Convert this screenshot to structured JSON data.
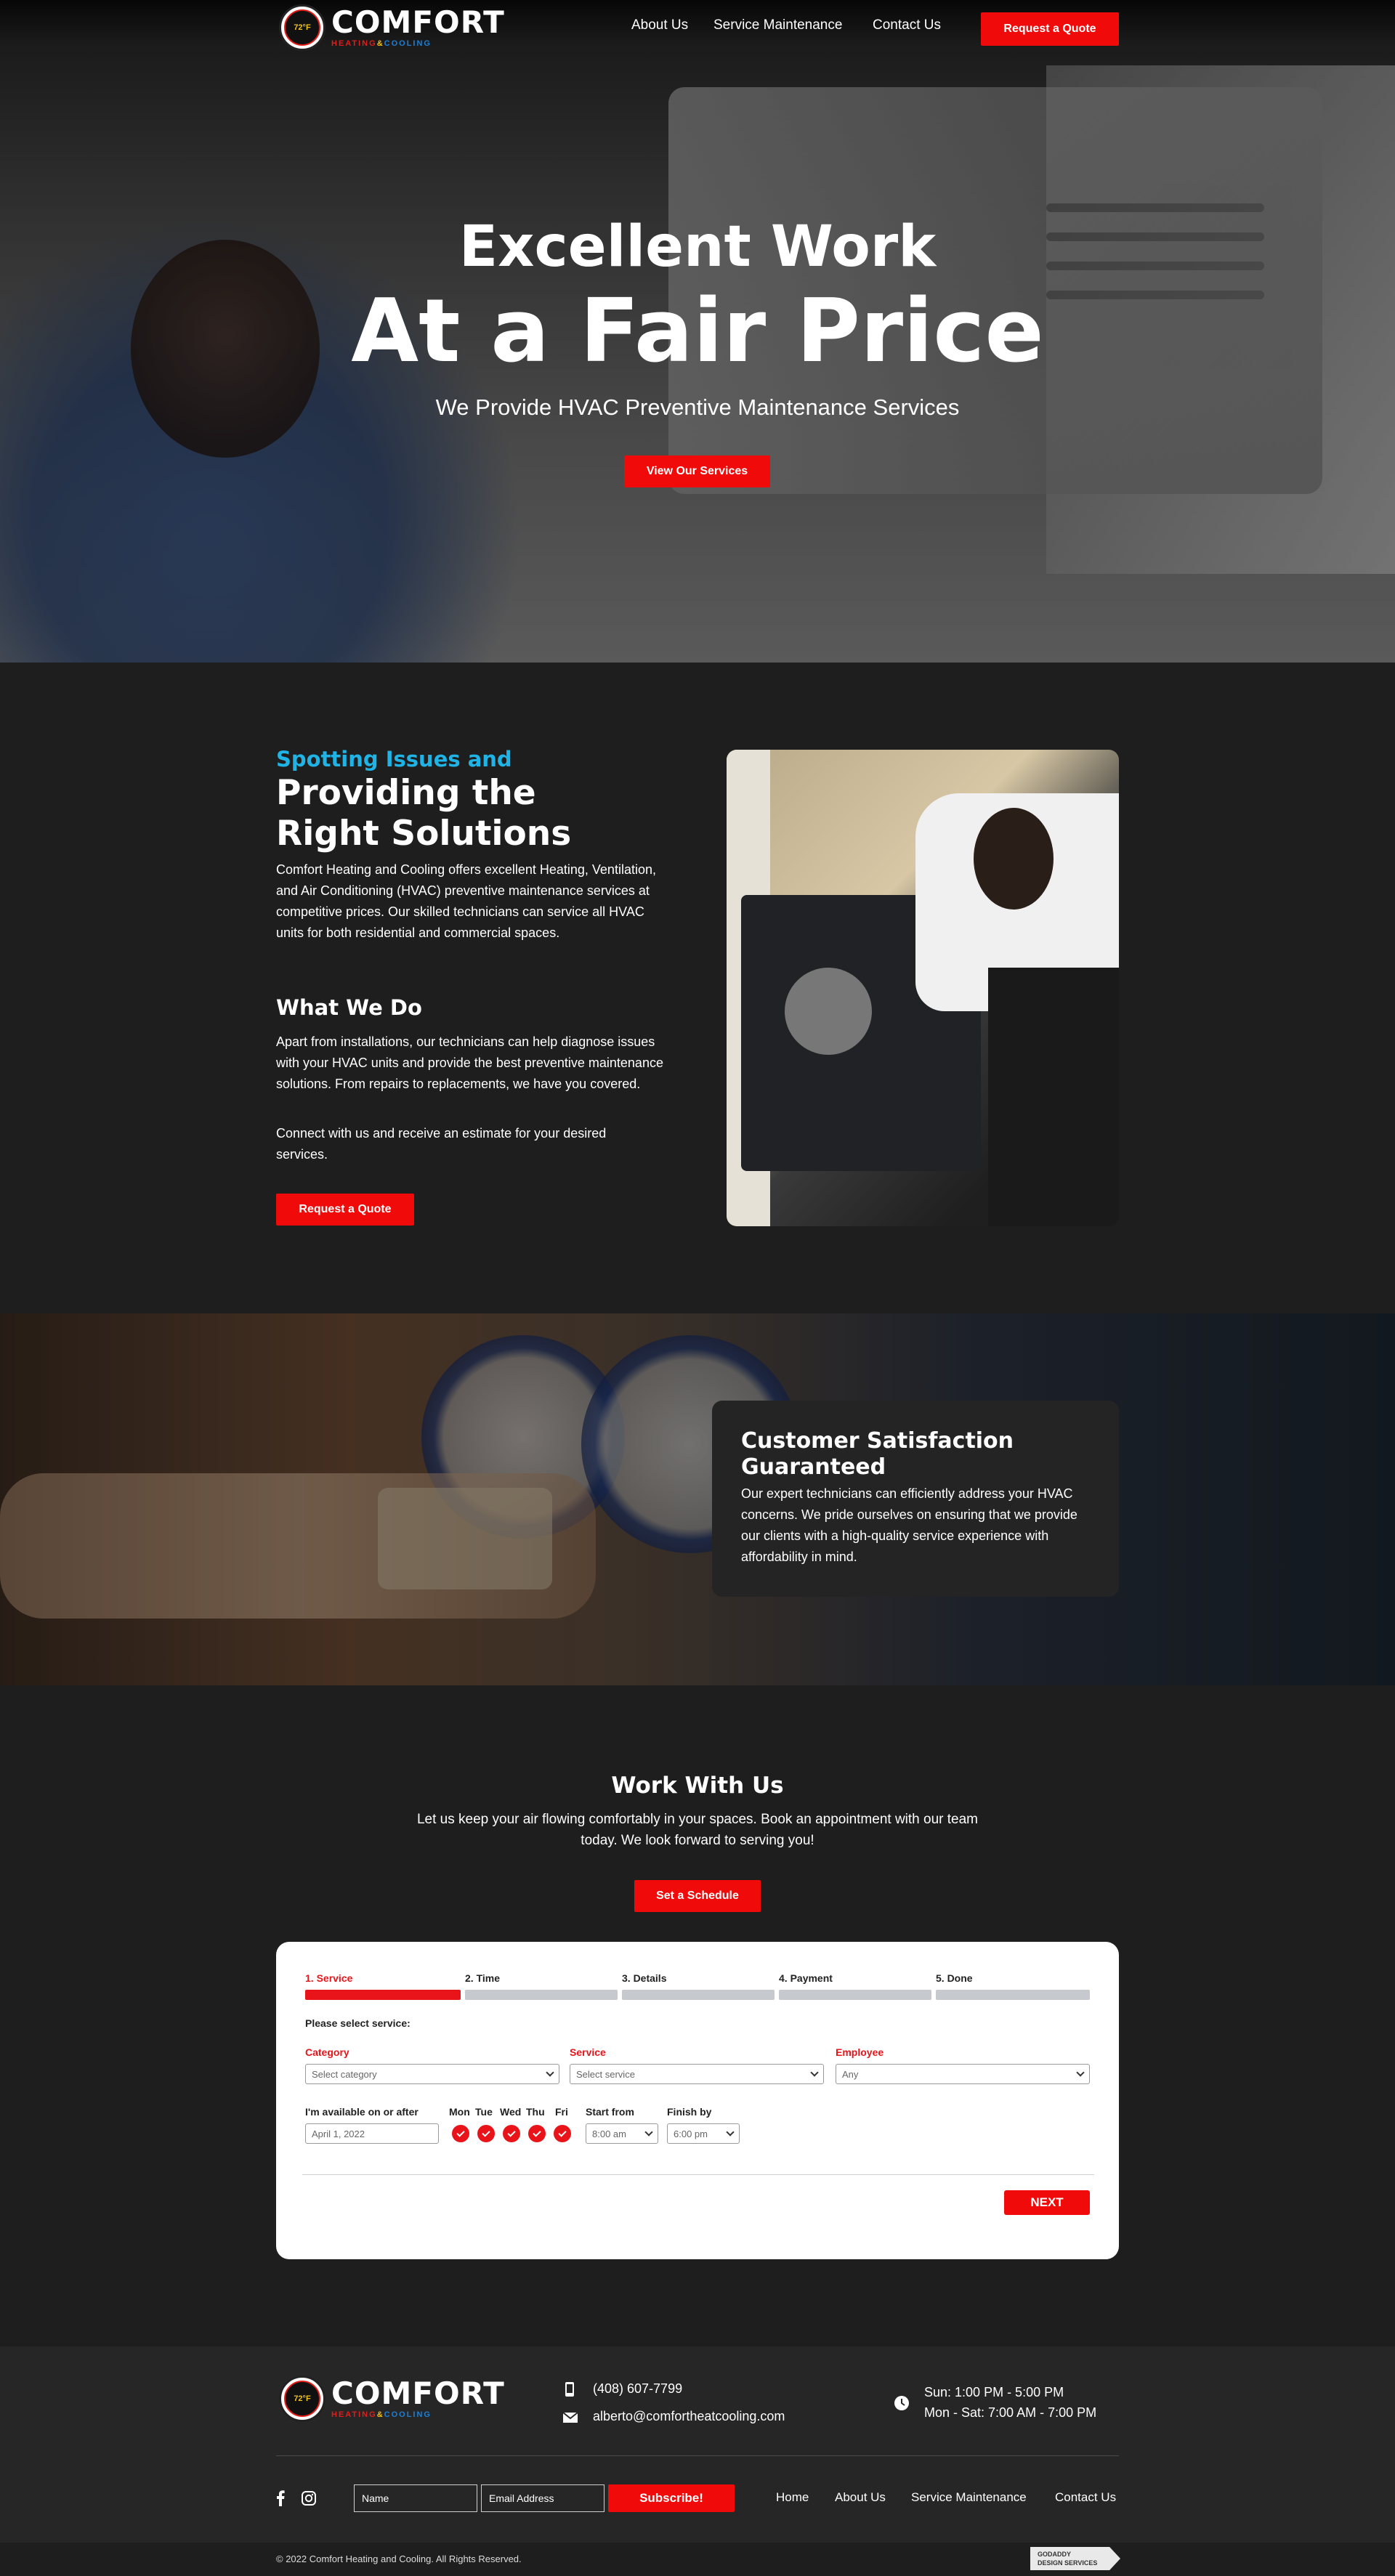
{
  "header": {
    "logo": {
      "badge_text": "72°F",
      "word": "COMFORT",
      "sub_heating": "HEATING",
      "sub_amp": "&",
      "sub_cooling": "COOLING"
    },
    "nav": [
      "About Us",
      "Service Maintenance",
      "Contact Us"
    ],
    "cta": "Request a Quote"
  },
  "hero": {
    "line1": "Excellent Work",
    "line2": "At a Fair Price",
    "subtitle": "We Provide HVAC Preventive Maintenance Services",
    "button": "View Our Services"
  },
  "intro": {
    "kicker": "Spotting Issues and",
    "title_line1": "Providing the",
    "title_line2": "Right Solutions",
    "para": "Comfort Heating and Cooling offers excellent Heating, Ventilation, and Air Conditioning (HVAC) preventive maintenance services at competitive prices. Our skilled technicians can service all HVAC units for both residential and commercial spaces.",
    "what_title": "What We Do",
    "what_para1": "Apart from installations, our technicians can help diagnose issues with your HVAC units and provide the best preventive maintenance solutions. From repairs to replacements, we have you covered.",
    "what_para2": "Connect with us and receive an estimate for your desired services.",
    "button": "Request a Quote"
  },
  "satisfaction": {
    "title": "Customer Satisfaction Guaranteed",
    "para": "Our expert technicians can efficiently address your HVAC concerns. We pride ourselves on ensuring that we provide our clients with a high-quality service experience with affordability in mind."
  },
  "work": {
    "title": "Work With Us",
    "para": "Let us keep your air flowing comfortably in your spaces. Book an appointment with our team today. We look forward to serving you!",
    "button": "Set a Schedule"
  },
  "booking": {
    "steps": [
      "1. Service",
      "2. Time",
      "3. Details",
      "4. Payment",
      "5. Done"
    ],
    "prompt": "Please select service:",
    "category_label": "Category",
    "category_value": "Select category",
    "service_label": "Service",
    "service_value": "Select service",
    "employee_label": "Employee",
    "employee_value": "Any",
    "available_label": "I'm available on or after",
    "date_value": "April 1, 2022",
    "days": [
      "Mon",
      "Tue",
      "Wed",
      "Thu",
      "Fri"
    ],
    "start_label": "Start from",
    "start_value": "8:00 am",
    "finish_label": "Finish by",
    "finish_value": "6:00 pm",
    "next": "NEXT",
    "colors": {
      "accent": "#e8141a",
      "inactive": "#c6c9cd"
    }
  },
  "footer": {
    "phone": "(408) 607-7799",
    "email": "alberto@comfortheatcooling.com",
    "hours_line1": "Sun: 1:00 PM - 5:00 PM",
    "hours_line2": "Mon - Sat: 7:00 AM - 7:00 PM",
    "name_placeholder": "Name",
    "email_placeholder": "Email Address",
    "subscribe": "Subscribe!",
    "links": [
      "Home",
      "About Us",
      "Service Maintenance",
      "Contact Us"
    ],
    "copyright": "© 2022 Comfort Heating and Cooling. All Rights Reserved.",
    "badge_line1": "GODADDY",
    "badge_line2": "DESIGN SERVICES"
  },
  "colors": {
    "brand_red": "#f00a0a",
    "kicker_blue": "#1fb3e6",
    "dark_bg": "#1e1e1e"
  }
}
